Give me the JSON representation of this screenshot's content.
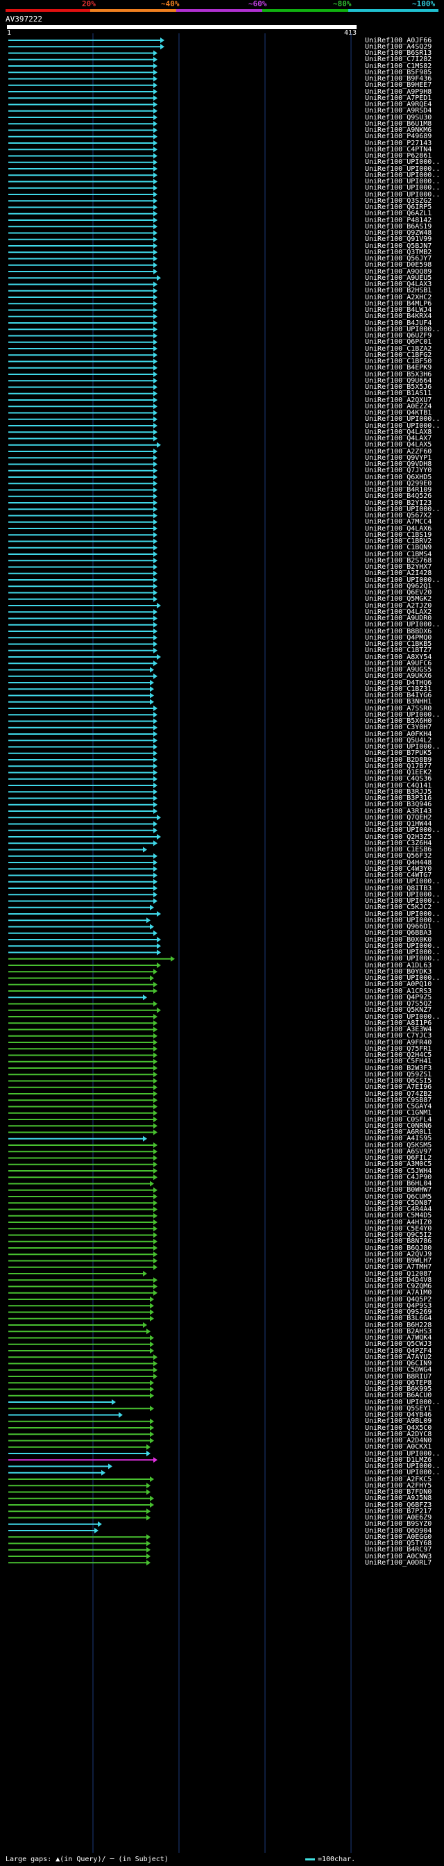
{
  "legend": {
    "labels": [
      "20%",
      "~40%",
      "~60%",
      "~80%",
      "~100%"
    ],
    "colors": [
      "#e01010",
      "#f08020",
      "#b030d0",
      "#10b010",
      "#20c0d0"
    ]
  },
  "query": {
    "id": "AV397222",
    "start": "1",
    "end": "413"
  },
  "hits": [
    {
      "id": "UniRef100_A0JF66",
      "c": "cy",
      "e": 0.45
    },
    {
      "id": "UniRef100_A4SQ29",
      "c": "cy",
      "e": 0.45
    },
    {
      "id": "UniRef100_B6SR13",
      "c": "cy",
      "e": 0.43
    },
    {
      "id": "UniRef100_C7I282",
      "c": "cy",
      "e": 0.43
    },
    {
      "id": "UniRef100_C1MS82",
      "c": "cy",
      "e": 0.43
    },
    {
      "id": "UniRef100_B5F985",
      "c": "cy",
      "e": 0.43
    },
    {
      "id": "UniRef100_B9F436",
      "c": "cy",
      "e": 0.43
    },
    {
      "id": "UniRef100_B9HEE7",
      "c": "cy",
      "e": 0.43
    },
    {
      "id": "UniRef100_A9P9H8",
      "c": "cy",
      "e": 0.43
    },
    {
      "id": "UniRef100_A7PED1",
      "c": "cy",
      "e": 0.43
    },
    {
      "id": "UniRef100_A9RQE4",
      "c": "cy",
      "e": 0.43
    },
    {
      "id": "UniRef100_A9RSD4",
      "c": "cy",
      "e": 0.43
    },
    {
      "id": "UniRef100_Q9SU30",
      "c": "cy",
      "e": 0.43
    },
    {
      "id": "UniRef100_B6U1M8",
      "c": "cy",
      "e": 0.43
    },
    {
      "id": "UniRef100_A9NKM6",
      "c": "cy",
      "e": 0.43
    },
    {
      "id": "UniRef100_P49689",
      "c": "cy",
      "e": 0.43
    },
    {
      "id": "UniRef100_P27143",
      "c": "cy",
      "e": 0.43
    },
    {
      "id": "UniRef100_C4PTN4",
      "c": "cy",
      "e": 0.43
    },
    {
      "id": "UniRef100_P62861",
      "c": "cy",
      "e": 0.43
    },
    {
      "id": "UniRef100_UPI000..",
      "c": "cy",
      "e": 0.43
    },
    {
      "id": "UniRef100_UPI000..",
      "c": "cy",
      "e": 0.43
    },
    {
      "id": "UniRef100_UPI000..",
      "c": "cy",
      "e": 0.43
    },
    {
      "id": "UniRef100_UPI000..",
      "c": "cy",
      "e": 0.43
    },
    {
      "id": "UniRef100_UPI000..",
      "c": "cy",
      "e": 0.43
    },
    {
      "id": "UniRef100_UPI000..",
      "c": "cy",
      "e": 0.43
    },
    {
      "id": "UniRef100_Q3SZG2",
      "c": "cy",
      "e": 0.43
    },
    {
      "id": "UniRef100_Q6IRP5",
      "c": "cy",
      "e": 0.43
    },
    {
      "id": "UniRef100_Q6AZL1",
      "c": "cy",
      "e": 0.43
    },
    {
      "id": "UniRef100_P48142",
      "c": "cy",
      "e": 0.43
    },
    {
      "id": "UniRef100_B6AS19",
      "c": "cy",
      "e": 0.43
    },
    {
      "id": "UniRef100_Q9ZW48",
      "c": "cy",
      "e": 0.43
    },
    {
      "id": "UniRef100_Q91V99",
      "c": "cy",
      "e": 0.43
    },
    {
      "id": "UniRef100_Q5BJN7",
      "c": "cy",
      "e": 0.43
    },
    {
      "id": "UniRef100_Q3TMB2",
      "c": "cy",
      "e": 0.43
    },
    {
      "id": "UniRef100_Q56JY7",
      "c": "cy",
      "e": 0.43
    },
    {
      "id": "UniRef100_D0E598",
      "c": "cy",
      "e": 0.43
    },
    {
      "id": "UniRef100_A9QQ89",
      "c": "cy",
      "e": 0.43
    },
    {
      "id": "UniRef100_A9UEU5",
      "c": "cy",
      "e": 0.44
    },
    {
      "id": "UniRef100_Q4LAX3",
      "c": "cy",
      "e": 0.43
    },
    {
      "id": "UniRef100_B2HSB1",
      "c": "cy",
      "e": 0.43
    },
    {
      "id": "UniRef100_A2XHC2",
      "c": "cy",
      "e": 0.43
    },
    {
      "id": "UniRef100_B4MLP6",
      "c": "cy",
      "e": 0.43
    },
    {
      "id": "UniRef100_B4LWJ4",
      "c": "cy",
      "e": 0.43
    },
    {
      "id": "UniRef100_B4KRX4",
      "c": "cy",
      "e": 0.43
    },
    {
      "id": "UniRef100_B4JUF4",
      "c": "cy",
      "e": 0.43
    },
    {
      "id": "UniRef100_UPI000..",
      "c": "cy",
      "e": 0.43
    },
    {
      "id": "UniRef100_Q6UZF9",
      "c": "cy",
      "e": 0.43
    },
    {
      "id": "UniRef100_Q6PC01",
      "c": "cy",
      "e": 0.43
    },
    {
      "id": "UniRef100_C1BZA2",
      "c": "cy",
      "e": 0.43
    },
    {
      "id": "UniRef100_C1BFG2",
      "c": "cy",
      "e": 0.43
    },
    {
      "id": "UniRef100_C1BF50",
      "c": "cy",
      "e": 0.43
    },
    {
      "id": "UniRef100_B4EPK9",
      "c": "cy",
      "e": 0.43
    },
    {
      "id": "UniRef100_B5X3H6",
      "c": "cy",
      "e": 0.43
    },
    {
      "id": "UniRef100_Q9U664",
      "c": "cy",
      "e": 0.43
    },
    {
      "id": "UniRef100_B5X5J6",
      "c": "cy",
      "e": 0.43
    },
    {
      "id": "UniRef100_B1AS11",
      "c": "cy",
      "e": 0.43
    },
    {
      "id": "UniRef100_A2QXU7",
      "c": "cy",
      "e": 0.43
    },
    {
      "id": "UniRef100_A0EZZ4",
      "c": "cy",
      "e": 0.43
    },
    {
      "id": "UniRef100_Q4KTB1",
      "c": "cy",
      "e": 0.43
    },
    {
      "id": "UniRef100_UPI000..",
      "c": "cy",
      "e": 0.43
    },
    {
      "id": "UniRef100_UPI000..",
      "c": "cy",
      "e": 0.43
    },
    {
      "id": "UniRef100_Q4LAX8",
      "c": "cy",
      "e": 0.43
    },
    {
      "id": "UniRef100_Q4LAX7",
      "c": "cy",
      "e": 0.43
    },
    {
      "id": "UniRef100_Q4LAX5",
      "c": "cy",
      "e": 0.44
    },
    {
      "id": "UniRef100_A2ZF60",
      "c": "cy",
      "e": 0.43
    },
    {
      "id": "UniRef100_Q9VYP1",
      "c": "cy",
      "e": 0.43
    },
    {
      "id": "UniRef100_Q9VDH8",
      "c": "cy",
      "e": 0.43
    },
    {
      "id": "UniRef100_Q7JYY0",
      "c": "cy",
      "e": 0.43
    },
    {
      "id": "UniRef100_Q6XHD5",
      "c": "cy",
      "e": 0.43
    },
    {
      "id": "UniRef100_Q299E0",
      "c": "cy",
      "e": 0.43
    },
    {
      "id": "UniRef100_B4R109",
      "c": "cy",
      "e": 0.43
    },
    {
      "id": "UniRef100_B4Q526",
      "c": "cy",
      "e": 0.43
    },
    {
      "id": "UniRef100_B2YI23",
      "c": "cy",
      "e": 0.43
    },
    {
      "id": "UniRef100_UPI000..",
      "c": "cy",
      "e": 0.43
    },
    {
      "id": "UniRef100_Q567X2",
      "c": "cy",
      "e": 0.43
    },
    {
      "id": "UniRef100_A7MCC4",
      "c": "cy",
      "e": 0.43
    },
    {
      "id": "UniRef100_Q4LAX6",
      "c": "cy",
      "e": 0.43
    },
    {
      "id": "UniRef100_C1BS19",
      "c": "cy",
      "e": 0.43
    },
    {
      "id": "UniRef100_C1BRV2",
      "c": "cy",
      "e": 0.43
    },
    {
      "id": "UniRef100_C1BQN9",
      "c": "cy",
      "e": 0.43
    },
    {
      "id": "UniRef100_C1BMS4",
      "c": "cy",
      "e": 0.43
    },
    {
      "id": "UniRef100_B2S768",
      "c": "cy",
      "e": 0.43
    },
    {
      "id": "UniRef100_B2YHX7",
      "c": "cy",
      "e": 0.43
    },
    {
      "id": "UniRef100_A2I428",
      "c": "cy",
      "e": 0.43
    },
    {
      "id": "UniRef100_UPI000..",
      "c": "cy",
      "e": 0.43
    },
    {
      "id": "UniRef100_Q962Q1",
      "c": "cy",
      "e": 0.43
    },
    {
      "id": "UniRef100_Q6EV20",
      "c": "cy",
      "e": 0.43
    },
    {
      "id": "UniRef100_Q5MGK2",
      "c": "cy",
      "e": 0.43
    },
    {
      "id": "UniRef100_A2TJZ0",
      "c": "cy",
      "e": 0.44
    },
    {
      "id": "UniRef100_Q4LAX2",
      "c": "cy",
      "e": 0.43
    },
    {
      "id": "UniRef100_A9UDR0",
      "c": "cy",
      "e": 0.43
    },
    {
      "id": "UniRef100_UPI000..",
      "c": "cy",
      "e": 0.43
    },
    {
      "id": "UniRef100_B8BDX6",
      "c": "cy",
      "e": 0.43
    },
    {
      "id": "UniRef100_Q4PMQ0",
      "c": "cy",
      "e": 0.43
    },
    {
      "id": "UniRef100_C1BKB5",
      "c": "cy",
      "e": 0.43
    },
    {
      "id": "UniRef100_C1BTZ7",
      "c": "cy",
      "e": 0.43
    },
    {
      "id": "UniRef100_A8XY54",
      "c": "cy",
      "e": 0.44
    },
    {
      "id": "UniRef100_A9UFC6",
      "c": "cy",
      "e": 0.43
    },
    {
      "id": "UniRef100_A9UGS5",
      "c": "cy",
      "e": 0.42
    },
    {
      "id": "UniRef100_A9UKX6",
      "c": "cy",
      "e": 0.43
    },
    {
      "id": "UniRef100_D4THQ6",
      "c": "cy",
      "e": 0.42
    },
    {
      "id": "UniRef100_C1BZ31",
      "c": "cy",
      "e": 0.42
    },
    {
      "id": "UniRef100_B4IYG6",
      "c": "cy",
      "e": 0.42
    },
    {
      "id": "UniRef100_B3NHH1",
      "c": "cy",
      "e": 0.42
    },
    {
      "id": "UniRef100_A7SSR0",
      "c": "cy",
      "e": 0.43
    },
    {
      "id": "UniRef100_UPI000..",
      "c": "cy",
      "e": 0.43
    },
    {
      "id": "UniRef100_B5X6H0",
      "c": "cy",
      "e": 0.43
    },
    {
      "id": "UniRef100_C3Y0H7",
      "c": "cy",
      "e": 0.43
    },
    {
      "id": "UniRef100_A0FKH4",
      "c": "cy",
      "e": 0.43
    },
    {
      "id": "UniRef100_Q5U4L2",
      "c": "cy",
      "e": 0.43
    },
    {
      "id": "UniRef100_UPI000..",
      "c": "cy",
      "e": 0.43
    },
    {
      "id": "UniRef100_B7PUK5",
      "c": "cy",
      "e": 0.43
    },
    {
      "id": "UniRef100_B2D8B9",
      "c": "cy",
      "e": 0.43
    },
    {
      "id": "UniRef100_Q17B77",
      "c": "cy",
      "e": 0.43
    },
    {
      "id": "UniRef100_Q1EEK2",
      "c": "cy",
      "e": 0.43
    },
    {
      "id": "UniRef100_C4QS36",
      "c": "cy",
      "e": 0.43
    },
    {
      "id": "UniRef100_C4Q141",
      "c": "cy",
      "e": 0.43
    },
    {
      "id": "UniRef100_B3RJJ5",
      "c": "cy",
      "e": 0.43
    },
    {
      "id": "UniRef100_B3P316",
      "c": "cy",
      "e": 0.43
    },
    {
      "id": "UniRef100_B3Q946",
      "c": "cy",
      "e": 0.43
    },
    {
      "id": "UniRef100_A3RI43",
      "c": "cy",
      "e": 0.43
    },
    {
      "id": "UniRef100_Q7QEH2",
      "c": "cy",
      "e": 0.44
    },
    {
      "id": "UniRef100_Q1HW44",
      "c": "cy",
      "e": 0.43
    },
    {
      "id": "UniRef100_UPI000..",
      "c": "cy",
      "e": 0.43
    },
    {
      "id": "UniRef100_Q2H3Z5",
      "c": "cy",
      "e": 0.44
    },
    {
      "id": "UniRef100_C3Z6H4",
      "c": "cy",
      "e": 0.43
    },
    {
      "id": "UniRef100_C1ES86",
      "c": "cy",
      "e": 0.4
    },
    {
      "id": "UniRef100_Q56F32",
      "c": "cy",
      "e": 0.43
    },
    {
      "id": "UniRef100_Q4H448",
      "c": "cy",
      "e": 0.43
    },
    {
      "id": "UniRef100_C4W3Y0",
      "c": "cy",
      "e": 0.43
    },
    {
      "id": "UniRef100_C4WTG7",
      "c": "cy",
      "e": 0.43
    },
    {
      "id": "UniRef100_UPI000..",
      "c": "cy",
      "e": 0.43
    },
    {
      "id": "UniRef100_Q8ITB3",
      "c": "cy",
      "e": 0.43
    },
    {
      "id": "UniRef100_UPI000..",
      "c": "cy",
      "e": 0.43
    },
    {
      "id": "UniRef100_UPI000..",
      "c": "cy",
      "e": 0.43
    },
    {
      "id": "UniRef100_C5KJC2",
      "c": "cy",
      "e": 0.42
    },
    {
      "id": "UniRef100_UPI000..",
      "c": "cy",
      "e": 0.44
    },
    {
      "id": "UniRef100_UPI000..",
      "c": "cy",
      "e": 0.41
    },
    {
      "id": "UniRef100_Q966D1",
      "c": "cy",
      "e": 0.42
    },
    {
      "id": "UniRef100_Q6BBA3",
      "c": "cy",
      "e": 0.43
    },
    {
      "id": "UniRef100_B0X0K0",
      "c": "cy",
      "e": 0.44
    },
    {
      "id": "UniRef100_UPI000..",
      "c": "cy",
      "e": 0.44
    },
    {
      "id": "UniRef100_UPI000..",
      "c": "cy",
      "e": 0.44
    },
    {
      "id": "UniRef100_UPI000..",
      "c": "gr",
      "e": 0.48
    },
    {
      "id": "UniRef100_A1DL63",
      "c": "gr",
      "e": 0.44
    },
    {
      "id": "UniRef100_B0YDK3",
      "c": "gr",
      "e": 0.43
    },
    {
      "id": "UniRef100_UPI000..",
      "c": "gr",
      "e": 0.42
    },
    {
      "id": "UniRef100_A0PQ10",
      "c": "gr",
      "e": 0.43
    },
    {
      "id": "UniRef100_A1CRS3",
      "c": "gr",
      "e": 0.43
    },
    {
      "id": "UniRef100_Q4P9Z5",
      "c": "cy",
      "e": 0.4
    },
    {
      "id": "UniRef100_Q7S5Q2",
      "c": "gr",
      "e": 0.43
    },
    {
      "id": "UniRef100_Q5KNZ7",
      "c": "gr",
      "e": 0.44
    },
    {
      "id": "UniRef100_UPI000..",
      "c": "gr",
      "e": 0.43
    },
    {
      "id": "UniRef100_A8I1P6",
      "c": "gr",
      "e": 0.43
    },
    {
      "id": "UniRef100_A3E3W4",
      "c": "gr",
      "e": 0.43
    },
    {
      "id": "UniRef100_C7YJC3",
      "c": "gr",
      "e": 0.43
    },
    {
      "id": "UniRef100_A9FR40",
      "c": "gr",
      "e": 0.43
    },
    {
      "id": "UniRef100_Q75FR1",
      "c": "gr",
      "e": 0.43
    },
    {
      "id": "UniRef100_Q2H4C5",
      "c": "gr",
      "e": 0.43
    },
    {
      "id": "UniRef100_C5FH41",
      "c": "gr",
      "e": 0.43
    },
    {
      "id": "UniRef100_B2W3F3",
      "c": "gr",
      "e": 0.43
    },
    {
      "id": "UniRef100_Q59ZS1",
      "c": "gr",
      "e": 0.43
    },
    {
      "id": "UniRef100_Q6CSI5",
      "c": "gr",
      "e": 0.43
    },
    {
      "id": "UniRef100_A7EI96",
      "c": "gr",
      "e": 0.43
    },
    {
      "id": "UniRef100_Q74ZB2",
      "c": "gr",
      "e": 0.43
    },
    {
      "id": "UniRef100_C9SB87",
      "c": "gr",
      "e": 0.43
    },
    {
      "id": "UniRef100_C5GAY4",
      "c": "gr",
      "e": 0.43
    },
    {
      "id": "UniRef100_C1GNM1",
      "c": "gr",
      "e": 0.43
    },
    {
      "id": "UniRef100_C0SFL4",
      "c": "gr",
      "e": 0.43
    },
    {
      "id": "UniRef100_C0NRN6",
      "c": "gr",
      "e": 0.43
    },
    {
      "id": "UniRef100_A6R0L1",
      "c": "gr",
      "e": 0.43
    },
    {
      "id": "UniRef100_A4IS95",
      "c": "cy",
      "e": 0.4
    },
    {
      "id": "UniRef100_Q5KSM5",
      "c": "gr",
      "e": 0.43
    },
    {
      "id": "UniRef100_A6SV97",
      "c": "gr",
      "e": 0.43
    },
    {
      "id": "UniRef100_Q6FIL2",
      "c": "gr",
      "e": 0.43
    },
    {
      "id": "UniRef100_A3M0C5",
      "c": "gr",
      "e": 0.43
    },
    {
      "id": "UniRef100_C5JWH4",
      "c": "gr",
      "e": 0.43
    },
    {
      "id": "UniRef100_C4JP90",
      "c": "gr",
      "e": 0.43
    },
    {
      "id": "UniRef100_B6HL04",
      "c": "gr",
      "e": 0.42
    },
    {
      "id": "UniRef100_B0WHW7",
      "c": "gr",
      "e": 0.43
    },
    {
      "id": "UniRef100_Q6CUM5",
      "c": "gr",
      "e": 0.43
    },
    {
      "id": "UniRef100_C5DN87",
      "c": "gr",
      "e": 0.43
    },
    {
      "id": "UniRef100_C4R4A4",
      "c": "gr",
      "e": 0.43
    },
    {
      "id": "UniRef100_C5M4D5",
      "c": "gr",
      "e": 0.43
    },
    {
      "id": "UniRef100_A4HIZ0",
      "c": "gr",
      "e": 0.43
    },
    {
      "id": "UniRef100_C5E4Y0",
      "c": "gr",
      "e": 0.43
    },
    {
      "id": "UniRef100_Q9C5I2",
      "c": "gr",
      "e": 0.43
    },
    {
      "id": "UniRef100_B8N786",
      "c": "gr",
      "e": 0.43
    },
    {
      "id": "UniRef100_B6QJ80",
      "c": "gr",
      "e": 0.43
    },
    {
      "id": "UniRef100_A2QVJ9",
      "c": "gr",
      "e": 0.43
    },
    {
      "id": "UniRef100_B9WLH7",
      "c": "gr",
      "e": 0.43
    },
    {
      "id": "UniRef100_A7TMH7",
      "c": "gr",
      "e": 0.43
    },
    {
      "id": "UniRef100_Q12087",
      "c": "gr",
      "e": 0.4
    },
    {
      "id": "UniRef100_D4D4V8",
      "c": "gr",
      "e": 0.43
    },
    {
      "id": "UniRef100_C9ZQM6",
      "c": "gr",
      "e": 0.43
    },
    {
      "id": "UniRef100_A7A1M0",
      "c": "gr",
      "e": 0.43
    },
    {
      "id": "UniRef100_Q4Q5P2",
      "c": "gr",
      "e": 0.42
    },
    {
      "id": "UniRef100_Q4P9S3",
      "c": "gr",
      "e": 0.42
    },
    {
      "id": "UniRef100_Q9S269",
      "c": "gr",
      "e": 0.42
    },
    {
      "id": "UniRef100_B3L6G4",
      "c": "gr",
      "e": 0.42
    },
    {
      "id": "UniRef100_B6H228",
      "c": "gr",
      "e": 0.4
    },
    {
      "id": "UniRef100_B2AHS3",
      "c": "gr",
      "e": 0.41
    },
    {
      "id": "UniRef100_A7WQK4",
      "c": "gr",
      "e": 0.42
    },
    {
      "id": "UniRef100_Q5CWJ3",
      "c": "gr",
      "e": 0.42
    },
    {
      "id": "UniRef100_Q4PZF4",
      "c": "gr",
      "e": 0.42
    },
    {
      "id": "UniRef100_A7AYU2",
      "c": "gr",
      "e": 0.43
    },
    {
      "id": "UniRef100_Q6CIN9",
      "c": "gr",
      "e": 0.43
    },
    {
      "id": "UniRef100_C5DWG4",
      "c": "gr",
      "e": 0.43
    },
    {
      "id": "UniRef100_B8RIU7",
      "c": "gr",
      "e": 0.43
    },
    {
      "id": "UniRef100_Q6TEP8",
      "c": "gr",
      "e": 0.42
    },
    {
      "id": "UniRef100_B6K995",
      "c": "gr",
      "e": 0.42
    },
    {
      "id": "UniRef100_B6ACU0",
      "c": "gr",
      "e": 0.42
    },
    {
      "id": "UniRef100_UPI000..",
      "c": "cy",
      "e": 0.31
    },
    {
      "id": "UniRef100_Q5SEY1",
      "c": "gr",
      "e": 0.42
    },
    {
      "id": "UniRef100_Q4YB46",
      "c": "cy",
      "e": 0.33
    },
    {
      "id": "UniRef100_A9BL09",
      "c": "gr",
      "e": 0.42
    },
    {
      "id": "UniRef100_Q4X5C0",
      "c": "gr",
      "e": 0.42
    },
    {
      "id": "UniRef100_A2DYC8",
      "c": "gr",
      "e": 0.42
    },
    {
      "id": "UniRef100_A2D4N0",
      "c": "gr",
      "e": 0.42
    },
    {
      "id": "UniRef100_A0CKX1",
      "c": "gr",
      "e": 0.41
    },
    {
      "id": "UniRef100_UPI000..",
      "c": "cy",
      "e": 0.41
    },
    {
      "id": "UniRef100_D1LMZ6",
      "c": "mg",
      "e": 0.43
    },
    {
      "id": "UniRef100_UPI000..",
      "c": "cy",
      "e": 0.3
    },
    {
      "id": "UniRef100_UPI000..",
      "c": "cy",
      "e": 0.28
    },
    {
      "id": "UniRef100_A2FKC5",
      "c": "gr",
      "e": 0.42
    },
    {
      "id": "UniRef100_A2FHY5",
      "c": "gr",
      "e": 0.41
    },
    {
      "id": "UniRef100_B7FDN0",
      "c": "gr",
      "e": 0.41
    },
    {
      "id": "UniRef100_A9J5N8",
      "c": "gr",
      "e": 0.42
    },
    {
      "id": "UniRef100_Q6BFZ3",
      "c": "gr",
      "e": 0.42
    },
    {
      "id": "UniRef100_B7P217",
      "c": "gr",
      "e": 0.41
    },
    {
      "id": "UniRef100_A0E6Z9",
      "c": "gr",
      "e": 0.41
    },
    {
      "id": "UniRef100_B9SYZ0",
      "c": "cy",
      "e": 0.27
    },
    {
      "id": "UniRef100_Q6D904",
      "c": "cy",
      "e": 0.26
    },
    {
      "id": "UniRef100_A0EGG0",
      "c": "gr",
      "e": 0.41
    },
    {
      "id": "UniRef100_Q5TY68",
      "c": "gr",
      "e": 0.41
    },
    {
      "id": "UniRef100_B4RC97",
      "c": "gr",
      "e": 0.41
    },
    {
      "id": "UniRef100_A0CNW3",
      "c": "gr",
      "e": 0.41
    },
    {
      "id": "UniRef100_A0DRL7",
      "c": "gr",
      "e": 0.41
    }
  ],
  "footer": {
    "gaps_text": "Large gaps: ▲(in Query)/ ─ (in Subject)",
    "scale_text": "=100char."
  },
  "colors": {
    "cyan": "#40d8e8",
    "green": "#48c030",
    "magenta": "#e030e0",
    "grid": "#1b3a7a"
  }
}
